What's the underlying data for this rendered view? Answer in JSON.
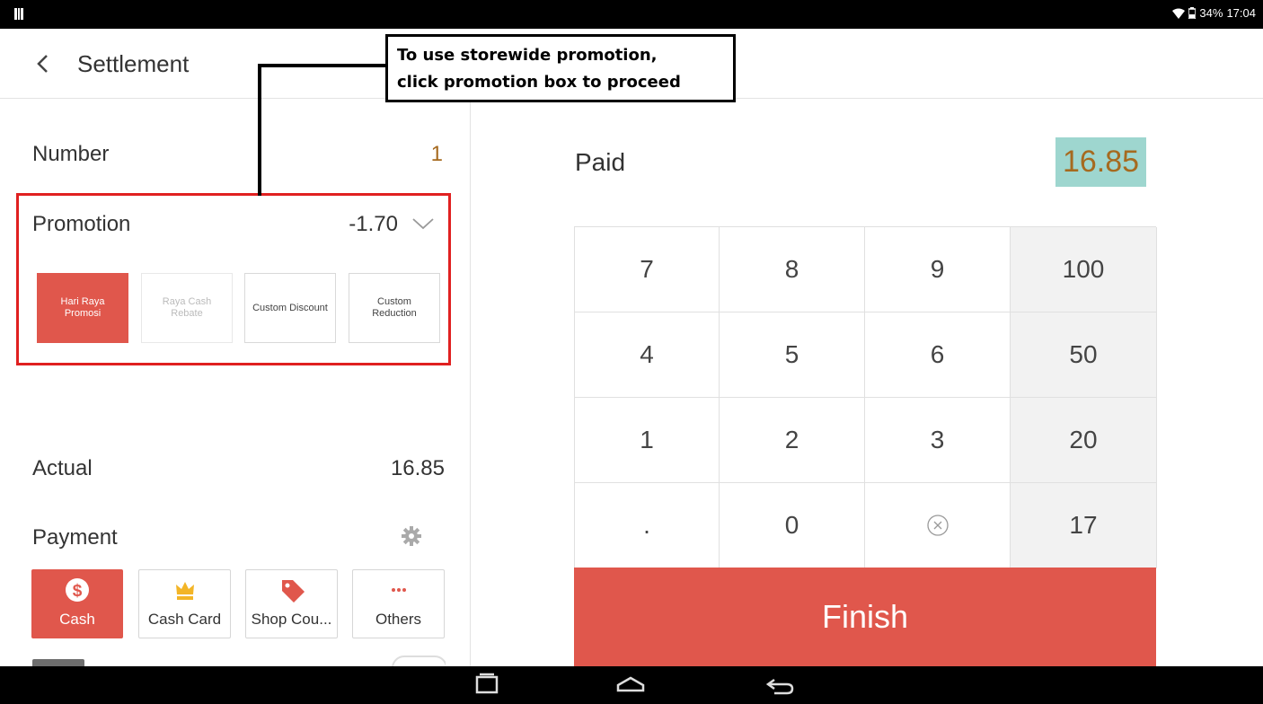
{
  "status_bar": {
    "battery": "34%",
    "time": "17:04"
  },
  "header": {
    "title": "Settlement"
  },
  "summary": {
    "number_label": "Number",
    "number_value": "1",
    "promotion_label": "Promotion",
    "promotion_value": "-1.70",
    "actual_label": "Actual",
    "actual_value": "16.85",
    "payment_label": "Payment"
  },
  "promotions": [
    {
      "label": "Hari Raya Promosi",
      "state": "selected"
    },
    {
      "label": "Raya Cash Rebate",
      "state": "disabled"
    },
    {
      "label": "Custom Discount",
      "state": "normal"
    },
    {
      "label": "Custom Reduction",
      "state": "normal"
    }
  ],
  "payment_methods": [
    {
      "label": "Cash",
      "icon": "dollar-icon",
      "selected": true
    },
    {
      "label": "Cash Card",
      "icon": "crown-icon",
      "selected": false
    },
    {
      "label": "Shop Cou...",
      "icon": "tag-icon",
      "selected": false
    },
    {
      "label": "Others",
      "icon": "more-icon",
      "selected": false
    }
  ],
  "paid": {
    "label": "Paid",
    "value": "16.85"
  },
  "keypad": {
    "keys": [
      "7",
      "8",
      "9",
      "4",
      "5",
      "6",
      "1",
      "2",
      "3",
      ".",
      "0",
      ""
    ],
    "quick_amounts": [
      "100",
      "50",
      "20",
      "17"
    ]
  },
  "finish_label": "Finish",
  "callout": {
    "line1": "To use storewide promotion,",
    "line2": "click promotion box to proceed"
  },
  "colors": {
    "accent": "#e0574c",
    "highlight": "#9ed6cf",
    "amount_text": "#a66a1f",
    "callout_border": "#e02020"
  }
}
